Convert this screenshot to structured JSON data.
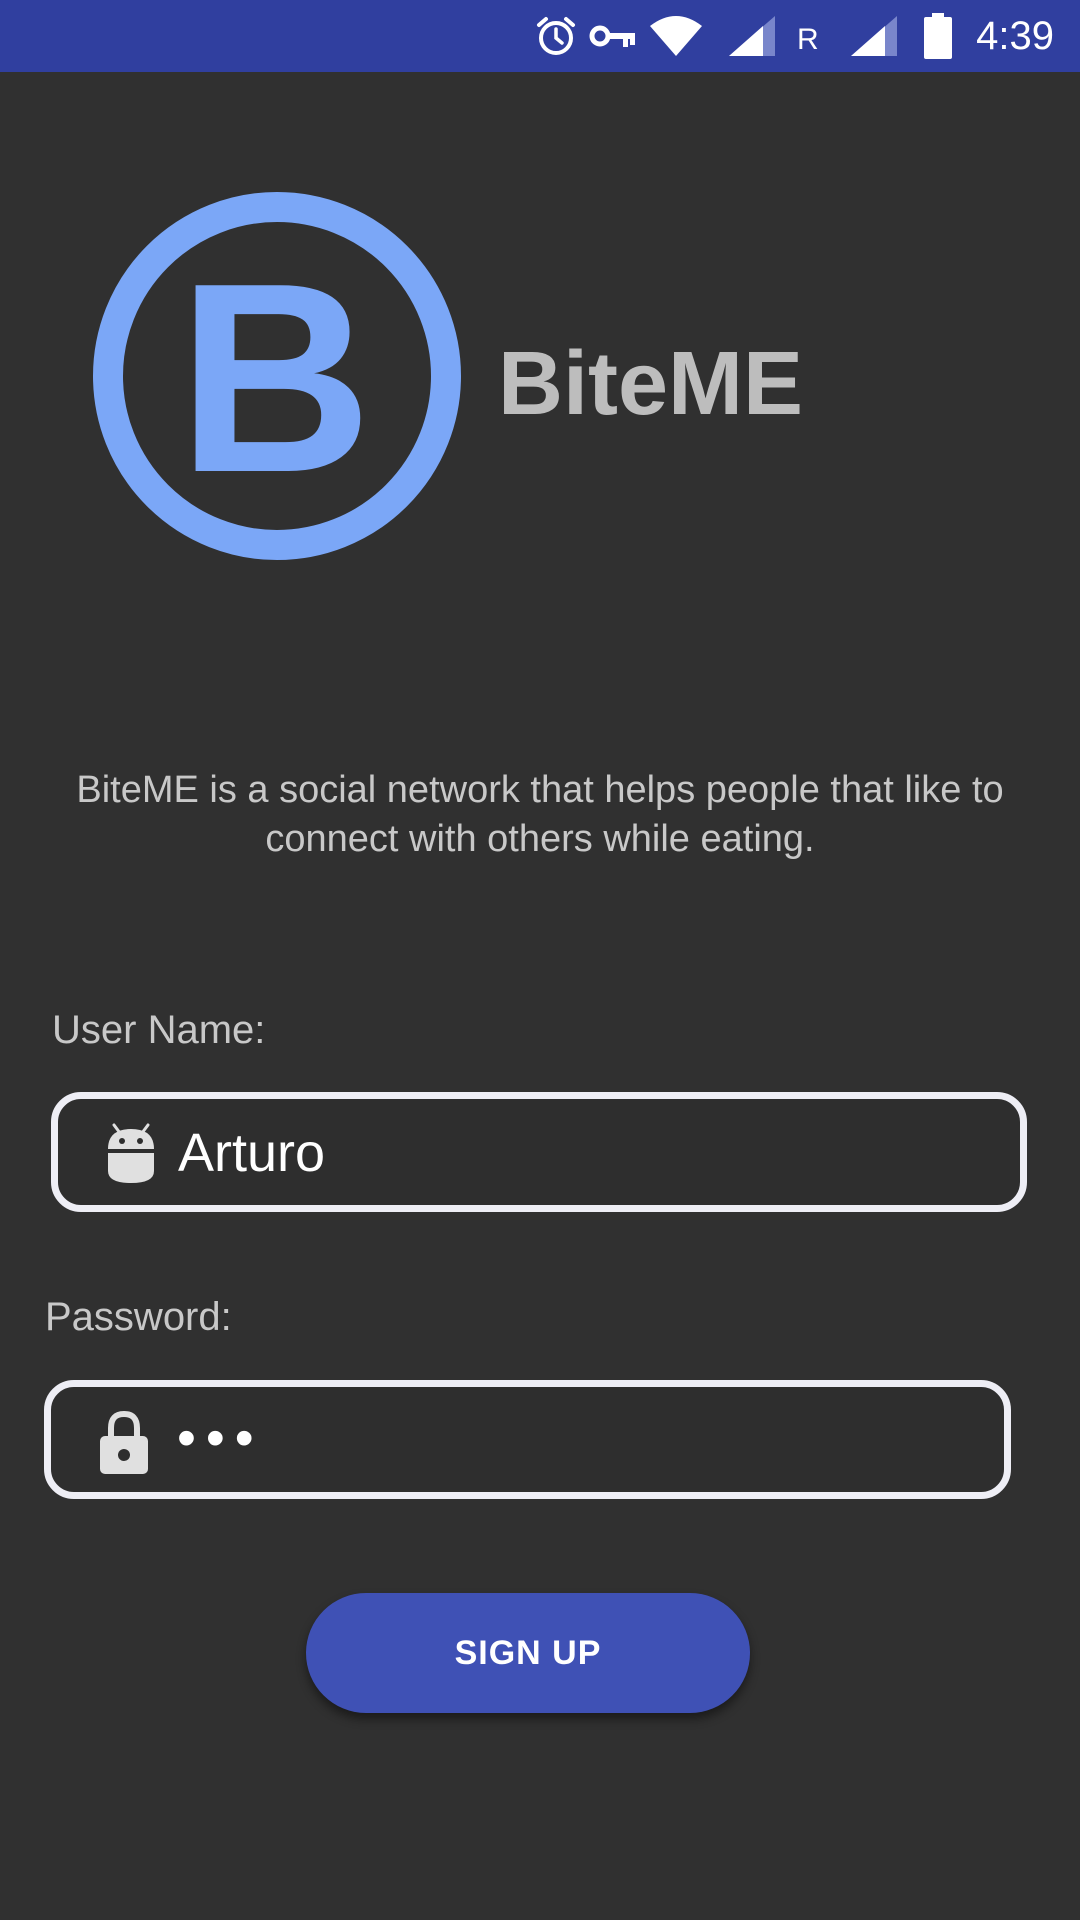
{
  "status_bar": {
    "time": "4:39",
    "roaming_indicator": "R",
    "icons": [
      "alarm-icon",
      "vpn-key-icon",
      "wifi-icon",
      "cell-signal-icon",
      "cell-signal-icon",
      "battery-icon"
    ],
    "background_color": "#303F9F"
  },
  "header": {
    "logo_letter": "B",
    "app_name": "BiteME",
    "logo_color": "#7BA7F7"
  },
  "description": "BiteME is a social network that helps people that like to connect with others while eating.",
  "form": {
    "username": {
      "label": "User Name:",
      "value": "Arturo",
      "icon": "android-icon"
    },
    "password": {
      "label": "Password:",
      "masked_value": "•••",
      "icon": "lock-icon"
    },
    "signup_button": {
      "label": "SIGN UP",
      "color": "#3F51B5"
    }
  },
  "colors": {
    "background": "#303030",
    "text_secondary": "#C8C8C8",
    "input_border": "#EEEEF5"
  }
}
